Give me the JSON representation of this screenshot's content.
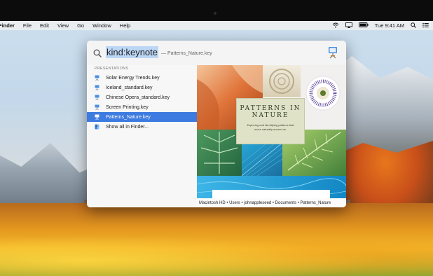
{
  "menubar": {
    "app_name": "Finder",
    "menus": [
      "File",
      "Edit",
      "View",
      "Go",
      "Window",
      "Help"
    ],
    "clock": "Tue 9:41 AM"
  },
  "spotlight": {
    "query": "kind:keynote",
    "suggestion": "— Patterns_Nature.key",
    "section_label": "PRESENTATIONS",
    "results": [
      {
        "label": "Solar Energy Trends.key",
        "icon": "keynote-file-icon",
        "selected": false
      },
      {
        "label": "Iceland_standard.key",
        "icon": "keynote-file-icon",
        "selected": false
      },
      {
        "label": "Chinese Opera_standard.key",
        "icon": "keynote-file-icon",
        "selected": false
      },
      {
        "label": "Screen Printing.key",
        "icon": "keynote-file-icon",
        "selected": false
      },
      {
        "label": "Patterns_Nature.key",
        "icon": "keynote-file-icon",
        "selected": true
      },
      {
        "label": "Show all in Finder...",
        "icon": "finder-icon",
        "selected": false
      }
    ],
    "preview": {
      "title": "PATTERNS IN NATURE",
      "subtitle": "Exploring and identifying patterns that occur naturally around us.",
      "path": "Macintosh HD • Users • johnappleseed • Documents • Patterns_Nature"
    }
  },
  "colors": {
    "selection": "#3d7be0",
    "query_highlight": "#bcd6f5",
    "menubar_bg": "#eceef0"
  }
}
